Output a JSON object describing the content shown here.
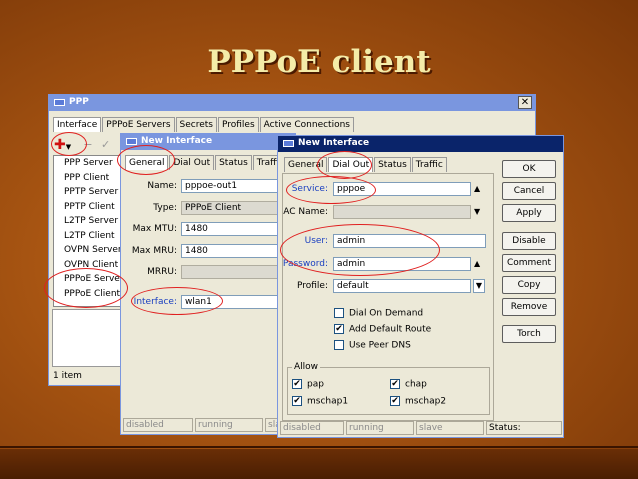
{
  "slide": {
    "title": "PPPoE client"
  },
  "ppp_window": {
    "title": "PPP",
    "tabs": [
      "Interface",
      "PPPoE Servers",
      "Secrets",
      "Profiles",
      "Active Connections"
    ],
    "menu_items": [
      "PPP Server",
      "PPP Client",
      "PPTP Server",
      "PPTP Client",
      "L2TP Server",
      "L2TP Client",
      "OVPN Server",
      "OVPN Client",
      "PPPoE Server",
      "PPPoE Client"
    ],
    "item_count": "1 item"
  },
  "new_interface_1": {
    "title": "New Interface",
    "tabs": [
      "General",
      "Dial Out",
      "Status",
      "Traffic"
    ],
    "labels": {
      "name": "Name:",
      "type": "Type:",
      "max_mtu": "Max MTU:",
      "max_mru": "Max MRU:",
      "mrru": "MRRU:",
      "interface": "Interface:"
    },
    "values": {
      "name": "pppoe-out1",
      "type": "PPPoE Client",
      "max_mtu": "1480",
      "max_mru": "1480",
      "mrru": "",
      "interface": "wlan1"
    },
    "status": [
      "disabled",
      "running",
      "sla"
    ]
  },
  "new_interface_2": {
    "title": "New Interface",
    "tabs": [
      "General",
      "Dial Out",
      "Status",
      "Traffic"
    ],
    "labels": {
      "service": "Service:",
      "ac_name": "AC Name:",
      "user": "User:",
      "password": "Password:",
      "profile": "Profile:"
    },
    "values": {
      "service": "pppoe",
      "ac_name": "",
      "user": "admin",
      "password": "admin",
      "profile": "default"
    },
    "checks": [
      {
        "label": "Dial On Demand",
        "checked": false
      },
      {
        "label": "Add Default Route",
        "checked": true
      },
      {
        "label": "Use Peer DNS",
        "checked": false
      }
    ],
    "allow_label": "Allow",
    "allow": [
      {
        "label": "pap",
        "checked": true
      },
      {
        "label": "chap",
        "checked": true
      },
      {
        "label": "mschap1",
        "checked": true
      },
      {
        "label": "mschap2",
        "checked": true
      }
    ],
    "buttons": [
      "OK",
      "Cancel",
      "Apply",
      "Disable",
      "Comment",
      "Copy",
      "Remove",
      "Torch"
    ],
    "status": [
      "disabled",
      "running",
      "slave",
      "Status:"
    ],
    "check_glyph": "✔"
  },
  "colors": {
    "titlebar_active": "#0a246a",
    "titlebar_inactive": "#7a96df",
    "highlight": "#e02020",
    "label_red": "#cc2020"
  }
}
